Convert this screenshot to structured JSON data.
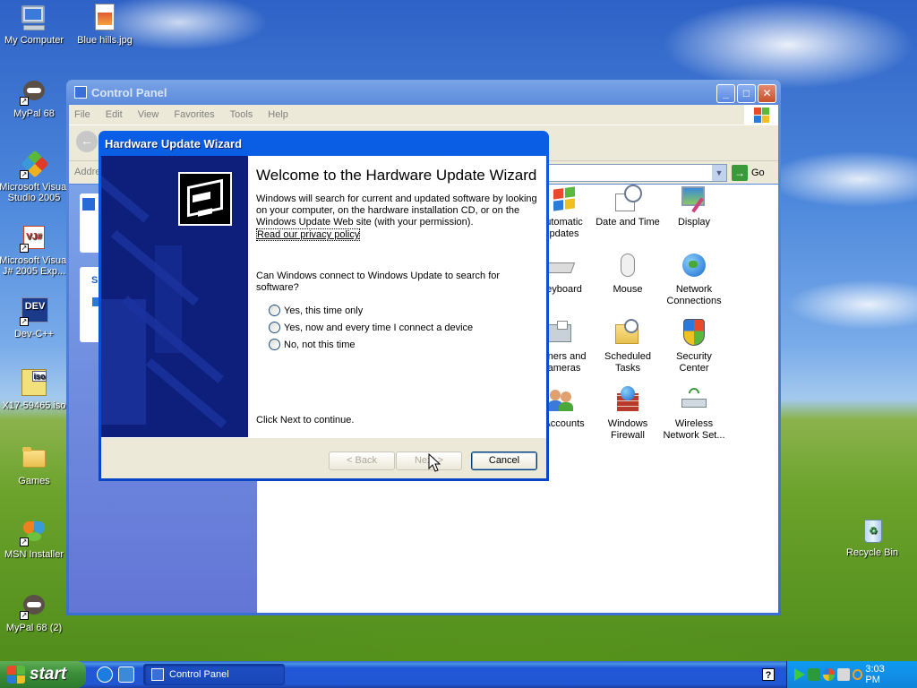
{
  "desktop": {
    "icons": [
      {
        "id": "my-computer",
        "label": "My Computer"
      },
      {
        "id": "blue-hills",
        "label": "Blue hills.jpg"
      },
      {
        "id": "mypal68",
        "label": "MyPal 68"
      },
      {
        "id": "vs2005",
        "label": "Microsoft Visual Studio 2005"
      },
      {
        "id": "vj2005",
        "label": "Microsoft Visual J# 2005 Exp..."
      },
      {
        "id": "devcpp",
        "label": "Dev-C++"
      },
      {
        "id": "iso",
        "label": "X17-59465.iso"
      },
      {
        "id": "games",
        "label": "Games"
      },
      {
        "id": "msn",
        "label": "MSN Installer"
      },
      {
        "id": "mypal68-2",
        "label": "MyPal 68 (2)"
      },
      {
        "id": "recycle",
        "label": "Recycle Bin"
      }
    ],
    "vs_label_1": "Microsoft Visual",
    "vs_label_2": "Studio 2005",
    "vj_label_1": "Microsoft Visual",
    "vj_label_2": "J# 2005 Exp...",
    "devcpp_badge": "DEV",
    "iso_badge": "iso",
    "vj_badge": "VJ#"
  },
  "control_panel": {
    "title": "Control Panel",
    "menu": [
      "File",
      "Edit",
      "View",
      "Favorites",
      "Tools",
      "Help"
    ],
    "address_label": "Addre",
    "go_label": "Go",
    "pane_partial": "S",
    "items": [
      {
        "line1": "utomatic",
        "line2": "pdates",
        "icon": "windows-update-icon"
      },
      {
        "line1": "Date and Time",
        "line2": "",
        "icon": "date-time-icon"
      },
      {
        "line1": "Display",
        "line2": "",
        "icon": "display-icon"
      },
      {
        "line1": "eyboard",
        "line2": "",
        "icon": "keyboard-icon"
      },
      {
        "line1": "Mouse",
        "line2": "",
        "icon": "mouse-icon"
      },
      {
        "line1": "Network",
        "line2": "Connections",
        "icon": "network-icon"
      },
      {
        "line1": "nners and",
        "line2": "ameras",
        "icon": "scanner-icon"
      },
      {
        "line1": "Scheduled",
        "line2": "Tasks",
        "icon": "scheduled-tasks-icon"
      },
      {
        "line1": "Security",
        "line2": "Center",
        "icon": "security-center-icon"
      },
      {
        "line1": "Accounts",
        "line2": "",
        "icon": "user-accounts-icon"
      },
      {
        "line1": "Windows",
        "line2": "Firewall",
        "icon": "firewall-icon"
      },
      {
        "line1": "Wireless",
        "line2": "Network Set...",
        "icon": "wireless-icon"
      }
    ]
  },
  "wizard": {
    "title": "Hardware Update Wizard",
    "heading": "Welcome to the Hardware Update Wizard",
    "intro": "Windows will search for current and updated software by looking on your computer, on the hardware installation CD, or on the Windows Update Web site (with your permission).",
    "privacy_link": "Read our privacy policy",
    "question": "Can Windows connect to Windows Update to search for software?",
    "options": [
      "Yes, this time only",
      "Yes, now and every time I connect a device",
      "No, not this time"
    ],
    "continue_text": "Click Next to continue.",
    "back_label": "< Back",
    "next_label": "Next >",
    "cancel_label": "Cancel"
  },
  "taskbar": {
    "start_label": "start",
    "task_item": "Control Panel",
    "help_glyph": "?",
    "clock": "3:03 PM"
  },
  "colors": {
    "xp_blue": "#0846c8",
    "start_green": "#3c8f3a",
    "tray_blue": "#0c9af0"
  }
}
